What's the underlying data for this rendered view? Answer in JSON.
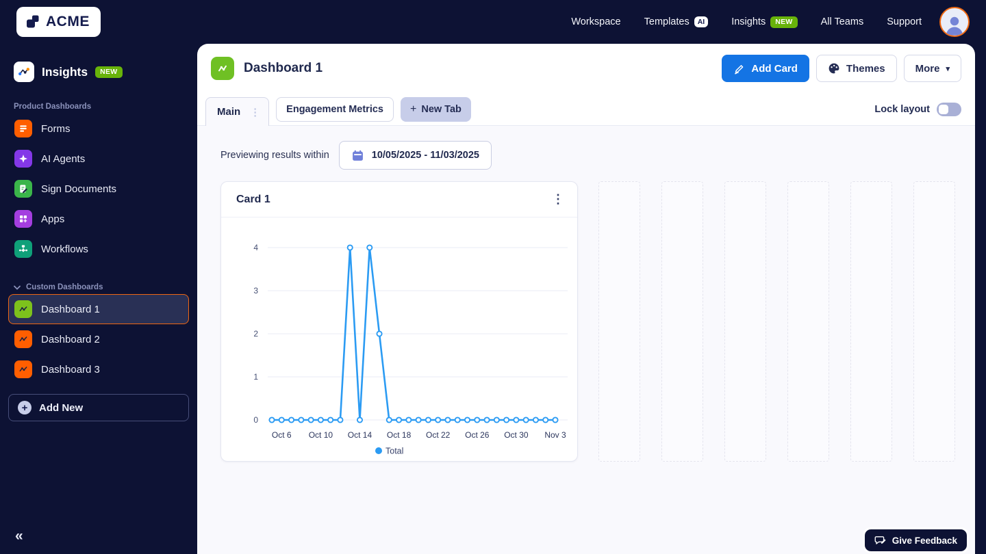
{
  "header": {
    "logo_text": "ACME",
    "nav_workspace": "Workspace",
    "nav_templates": "Templates",
    "ai_badge": "AI",
    "nav_insights": "Insights",
    "new_badge": "NEW",
    "nav_all_teams": "All Teams",
    "nav_support": "Support"
  },
  "sidebar": {
    "app_title": "Insights",
    "app_badge": "NEW",
    "product_section": "Product Dashboards",
    "items": {
      "forms": "Forms",
      "ai_agents": "AI Agents",
      "sign_documents": "Sign Documents",
      "apps": "Apps",
      "workflows": "Workflows"
    },
    "custom_section": "Custom Dashboards",
    "dashboards": [
      "Dashboard 1",
      "Dashboard 2",
      "Dashboard 3"
    ],
    "add_new": "Add New"
  },
  "main": {
    "title": "Dashboard 1",
    "add_card": "Add Card",
    "themes": "Themes",
    "more": "More",
    "tab_main": "Main",
    "tab_engagement": "Engagement Metrics",
    "tab_new": "New Tab",
    "lock_layout": "Lock layout",
    "preview_label": "Previewing results within",
    "date_range": "10/05/2025 - 11/03/2025",
    "card_title": "Card 1"
  },
  "feedback": {
    "label": "Give Feedback"
  },
  "glyphs": {
    "plus": "+",
    "kebab": "⋮",
    "tab_dots": "⋮",
    "caret": "▾",
    "collapse": "«"
  },
  "colors": {
    "accent_blue": "#1474e4",
    "chart_line": "#2b9bf3",
    "badge_green": "#68b30a",
    "selected_orange": "#ee6612",
    "page_bg": "#0d1234"
  },
  "chart_data": {
    "type": "line",
    "title": "Card 1",
    "x": [
      "Oct 5",
      "Oct 6",
      "Oct 7",
      "Oct 8",
      "Oct 9",
      "Oct 10",
      "Oct 11",
      "Oct 12",
      "Oct 13",
      "Oct 14",
      "Oct 15",
      "Oct 16",
      "Oct 17",
      "Oct 18",
      "Oct 19",
      "Oct 20",
      "Oct 21",
      "Oct 22",
      "Oct 23",
      "Oct 24",
      "Oct 25",
      "Oct 26",
      "Oct 27",
      "Oct 28",
      "Oct 29",
      "Oct 30",
      "Oct 31",
      "Nov 1",
      "Nov 2",
      "Nov 3"
    ],
    "series": [
      {
        "name": "Total",
        "values": [
          0,
          0,
          0,
          0,
          0,
          0,
          0,
          0,
          4,
          0,
          4,
          2,
          0,
          0,
          0,
          0,
          0,
          0,
          0,
          0,
          0,
          0,
          0,
          0,
          0,
          0,
          0,
          0,
          0,
          0
        ]
      }
    ],
    "ylim": [
      0,
      4
    ],
    "y_ticks": [
      0,
      1,
      2,
      3,
      4
    ],
    "x_tick_indices": [
      1,
      5,
      9,
      13,
      17,
      21,
      25,
      29
    ],
    "grid": true,
    "legend_position": "bottom",
    "line_color": "#2b9bf3"
  }
}
